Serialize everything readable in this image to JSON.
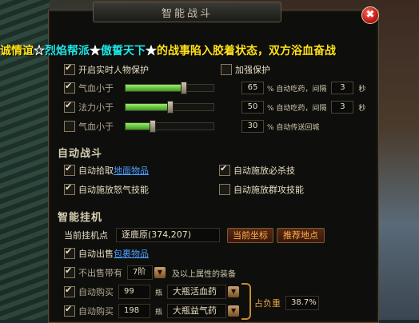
{
  "window": {
    "title": "智能战斗",
    "close_glyph": "✖"
  },
  "marquee": {
    "part1": "诚情谊",
    "star1": "☆",
    "part2": "烈焰帮派",
    "star2": "★",
    "part3": "傲誓天下",
    "star3": "★",
    "part4": "的战事陷入胶着状态，双方浴血奋战"
  },
  "protect": {
    "realtime_label": "开启实时人物保护",
    "strengthen_label": "加强保护",
    "hp_label": "气血小于",
    "hp_value": "65",
    "hp_suffix": "% 自动吃药，间隔",
    "hp_interval": "3",
    "hp_unit": "秒",
    "mp_label": "法力小于",
    "mp_value": "50",
    "mp_suffix": "% 自动吃药，间隔",
    "mp_interval": "3",
    "mp_unit": "秒",
    "hp2_label": "气血小于",
    "hp2_value": "30",
    "hp2_suffix": "% 自动传送回城",
    "sliders": {
      "hp": 0.65,
      "mp": 0.5,
      "hp2": 0.3
    }
  },
  "auto_battle": {
    "heading": "自动战斗",
    "pickup_label": "自动拾取",
    "pickup_link": "地面物品",
    "release_must_kill": "自动施放必杀技",
    "release_rage": "自动施放怒气技能",
    "release_group": "自动施放群攻技能"
  },
  "auto_hang": {
    "heading": "智能挂机",
    "point_label": "当前挂机点",
    "point_value": "逐鹿原(374,207)",
    "current_btn": "当前坐标",
    "recommend_btn": "推荐地点",
    "sell_label": "自动出售",
    "sell_link": "包裹物品",
    "nosell_label": "不出售带有",
    "nosell_level": "7阶",
    "nosell_suffix": "及以上属性的装备",
    "buy1_label": "自动购买",
    "buy1_qty": "99",
    "buy1_unit": "瓶",
    "buy1_item": "大瓶活血药",
    "buy2_label": "自动购买",
    "buy2_qty": "198",
    "buy2_unit": "瓶",
    "buy2_item": "大瓶益气药",
    "weight_label": "占负重",
    "weight_value": "38.7%"
  },
  "colors": {
    "accent": "#ffe21a",
    "link": "#4aa0ff",
    "button_text": "#ffb24a"
  }
}
